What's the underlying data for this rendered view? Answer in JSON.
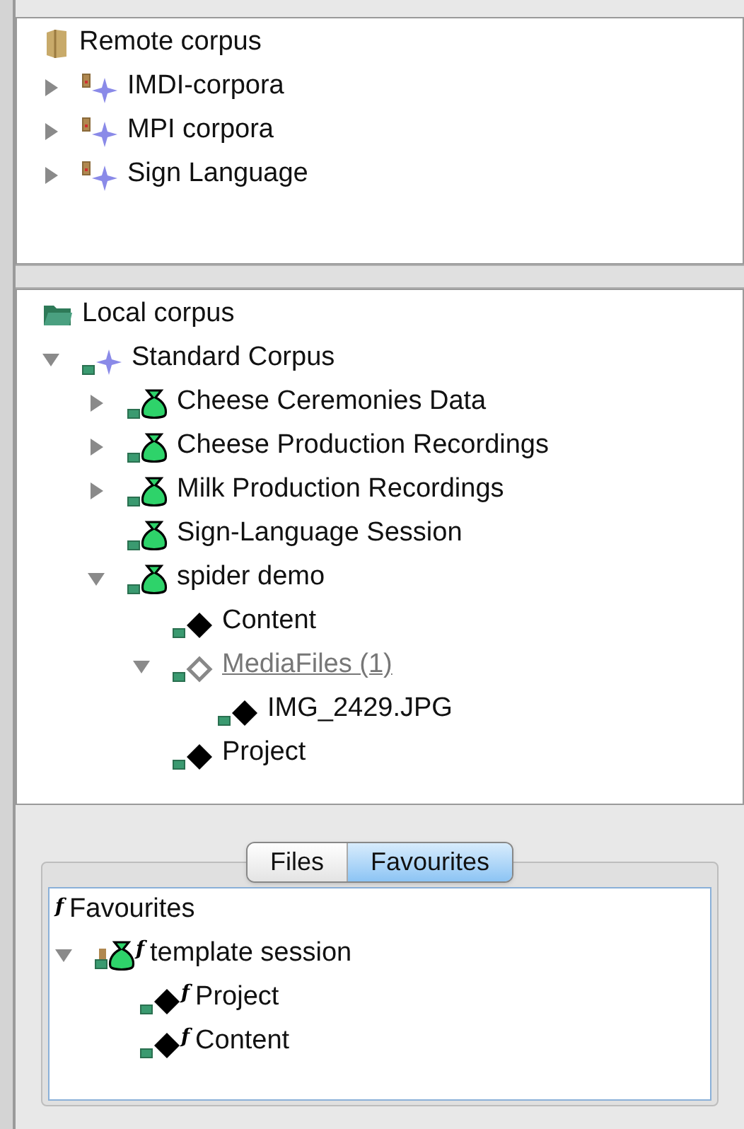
{
  "remote_tree": {
    "label": "Remote corpus",
    "children": [
      {
        "label": "IMDI-corpora",
        "kind": "corpus",
        "expanded": false
      },
      {
        "label": "MPI corpora",
        "kind": "corpus",
        "expanded": false
      },
      {
        "label": "Sign Language",
        "kind": "corpus",
        "expanded": false
      }
    ]
  },
  "local_tree": {
    "label": "Local corpus",
    "children": [
      {
        "label": "Standard Corpus",
        "kind": "corpus",
        "expanded": true,
        "children": [
          {
            "label": "Cheese Ceremonies Data",
            "kind": "session",
            "expanded": false
          },
          {
            "label": "Cheese Production Recordings",
            "kind": "session",
            "expanded": false
          },
          {
            "label": "Milk Production Recordings",
            "kind": "session",
            "expanded": false
          },
          {
            "label": "Sign-Language Session",
            "kind": "session"
          },
          {
            "label": "spider demo",
            "kind": "session",
            "expanded": true,
            "children": [
              {
                "label": "Content",
                "kind": "node"
              },
              {
                "label": "MediaFiles (1)",
                "kind": "media",
                "expanded": true,
                "children": [
                  {
                    "label": "IMG_2429.JPG",
                    "kind": "node"
                  }
                ]
              },
              {
                "label": "Project",
                "kind": "node"
              }
            ]
          }
        ]
      }
    ]
  },
  "tabs": [
    {
      "label": "Files",
      "selected": false
    },
    {
      "label": "Favourites",
      "selected": true
    }
  ],
  "favourites_tree": {
    "label": "Favourites",
    "mark": "f",
    "children": [
      {
        "label": "template session",
        "kind": "session",
        "mark": "f",
        "expanded": true,
        "children": [
          {
            "label": "Project",
            "kind": "node",
            "mark": "f"
          },
          {
            "label": "Content",
            "kind": "node",
            "mark": "f"
          }
        ]
      }
    ]
  }
}
